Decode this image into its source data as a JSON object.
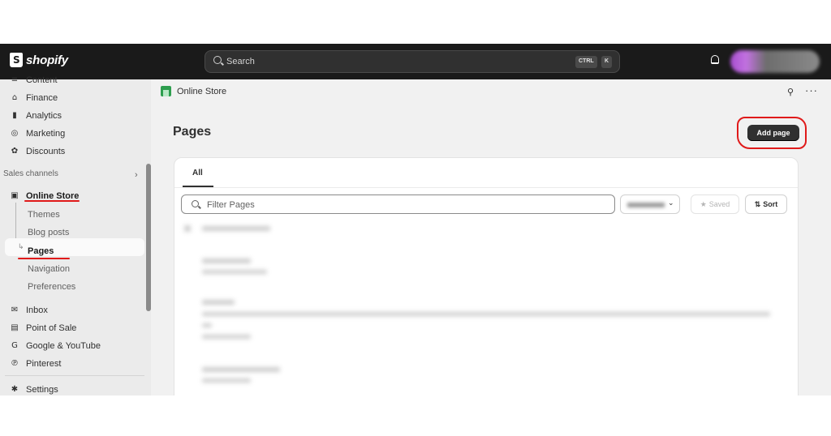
{
  "topbar": {
    "brand": "shopify",
    "search_placeholder": "Search",
    "shortcut_ctrl": "CTRL",
    "shortcut_k": "K"
  },
  "sidebar": {
    "top_items": [
      {
        "label": "Finance",
        "icon": "bank-icon"
      },
      {
        "label": "Analytics",
        "icon": "bar-chart-icon"
      },
      {
        "label": "Marketing",
        "icon": "target-icon"
      },
      {
        "label": "Discounts",
        "icon": "gear-icon"
      }
    ],
    "channels_heading": "Sales channels",
    "online_store": "Online Store",
    "sub_items": [
      "Themes",
      "Blog posts",
      "Pages",
      "Navigation",
      "Preferences"
    ],
    "active_sub": "Pages",
    "bottom_items": [
      {
        "label": "Inbox",
        "icon": "inbox-icon"
      },
      {
        "label": "Point of Sale",
        "icon": "pos-icon"
      },
      {
        "label": "Google & YouTube",
        "icon": "google-icon"
      },
      {
        "label": "Pinterest",
        "icon": "pinterest-icon"
      }
    ],
    "settings": "Settings"
  },
  "main": {
    "breadcrumb": "Online Store",
    "title": "Pages",
    "add_button": "Add page",
    "tab_all": "All",
    "filter_placeholder": "Filter Pages",
    "saved_label": "Saved",
    "sort_label": "Sort"
  },
  "colors": {
    "topbar_bg": "#1a1a1a",
    "primary_button": "#303030",
    "annotation_red": "#e01a1a",
    "store_icon_green": "#2e9e4f"
  }
}
